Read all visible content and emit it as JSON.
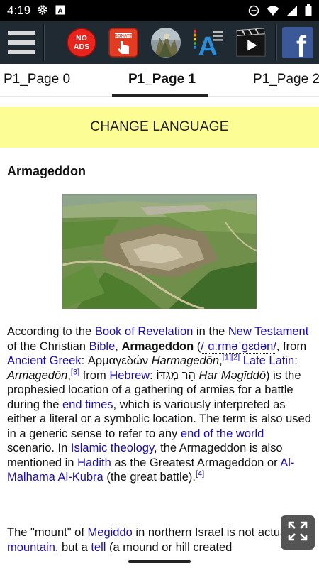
{
  "status_bar": {
    "time": "4:19",
    "icons": [
      "gear-icon",
      "font-a-icon",
      "dnd-icon",
      "wifi-icon",
      "signal-icon",
      "battery-icon"
    ]
  },
  "toolbar": {
    "menu_icon": "hamburger-menu-icon",
    "no_ads_label": "NO ADS",
    "donate_label": "DONATE",
    "buttons": [
      "no-ads",
      "donate",
      "bible-art",
      "font-size",
      "video",
      "facebook"
    ],
    "facebook_glyph": "f",
    "font_glyph": "A"
  },
  "tabs": [
    {
      "label": "P1_Page 0"
    },
    {
      "label": "P1_Page 1",
      "active": true
    },
    {
      "label": "P1_Page 2"
    }
  ],
  "change_language": "CHANGE LANGUAGE",
  "article": {
    "title": "Armageddon",
    "image_alt": "Aerial view of Tel Megiddo",
    "p1": {
      "t1": "According to the ",
      "l1": "Book of Revelation",
      "t2": " in the ",
      "l2": "New Testament",
      "t3": " of the Christian ",
      "l3": "Bible",
      "t4": ", ",
      "b1": "Armageddon",
      "t5": " (",
      "l4": "/ˌɑːrməˈɡɛdən/",
      "t6": ", from ",
      "l5": "Ancient Greek",
      "t7": ": Ἁρμαγεδών ",
      "i1": "Harmagedōn",
      "t8": ",",
      "s1": "[1]",
      "s2": "[2]",
      "t9": " ",
      "l6": "Late Latin",
      "t10": ": ",
      "i2": "Armagedōn",
      "t11": ",",
      "s3": "[3]",
      "t12": " from ",
      "l7": "Hebrew",
      "t13": ": הַר מְגִדּוֹ ",
      "i3": "Har Məgīddō",
      "t14": ") is the prophesied location of a gathering of armies for a battle during the ",
      "l8": "end times",
      "t15": ", which is variously interpreted as either a literal or a symbolic location. The term is also used in a generic sense to refer to any ",
      "l9": "end of the world",
      "t16": " scenario. In ",
      "l10": "Islamic theology",
      "t17": ", the Armageddon is also mentioned in ",
      "l11": "Hadith",
      "t18": " as the Greatest Armageddon or ",
      "l12": "Al-Malhama Al-Kubra",
      "t19": " (the great battle).",
      "s4": "[4]"
    },
    "p2": {
      "t1": "The \"mount\" of ",
      "l1": "Megiddo",
      "t2": " in northern Israel is not actually a ",
      "l2": "mountain",
      "t3": ", but a ",
      "l3": "tell",
      "t4": " (a mound or hill created"
    }
  },
  "fullscreen_icon": "expand-arrows-icon",
  "colors": {
    "toolbar_bg": "#202a33",
    "change_language_bg": "#fdfd96",
    "link": "#1a0dab",
    "no_ads_red": "#e8241c",
    "facebook_blue": "#3b5998"
  }
}
